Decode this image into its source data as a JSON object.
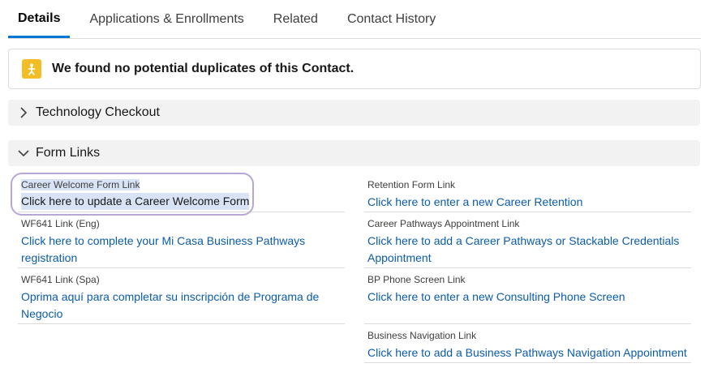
{
  "tabs": [
    {
      "label": "Details",
      "active": true
    },
    {
      "label": "Applications & Enrollments",
      "active": false
    },
    {
      "label": "Related",
      "active": false
    },
    {
      "label": "Contact History",
      "active": false
    }
  ],
  "duplicates": {
    "message": "We found no potential duplicates of this Contact.",
    "icon": "duplicate-contact-icon",
    "icon_color": "#f4bc25"
  },
  "sections": {
    "technology": {
      "title": "Technology Checkout",
      "expanded": false
    },
    "form_links": {
      "title": "Form Links",
      "expanded": true
    }
  },
  "fields": {
    "career_welcome": {
      "label": "Career Welcome Form Link",
      "value": "Click here to update a Career Welcome Form"
    },
    "retention": {
      "label": "Retention Form Link",
      "value": "Click here to enter a new Career Retention"
    },
    "wf641_eng": {
      "label": "WF641 Link (Eng)",
      "value_line1": "Click here to complete your Mi Casa Business Pathways",
      "value_line2": "registration"
    },
    "career_pathways": {
      "label": "Career Pathways Appointment Link",
      "value_line1": "Click here to add a Career Pathways or Stackable Credentials",
      "value_line2": "Appointment"
    },
    "wf641_spa": {
      "label": "WF641 Link (Spa)",
      "value_line1": "Oprima aquí para completar su inscripción de Programa de",
      "value_line2": "Negocio"
    },
    "bp_phone": {
      "label": "BP Phone Screen Link",
      "value": "Click here to enter a new Consulting Phone Screen"
    },
    "business_nav": {
      "label": "Business Navigation Link",
      "value": "Click here to add a Business Pathways Navigation Appointment"
    }
  },
  "colors": {
    "link": "#0b5cab",
    "accent": "#0176d3",
    "highlight_oval": "#b6a7d8"
  }
}
